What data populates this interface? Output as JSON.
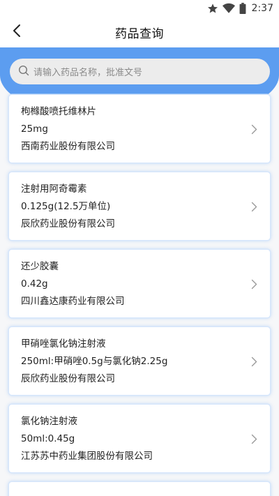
{
  "status_bar": {
    "time": "2:37"
  },
  "nav": {
    "title": "药品查询"
  },
  "search": {
    "placeholder": "请输入药品名称，批准文号"
  },
  "drugs": [
    {
      "name": "枸橼酸喷托维林片",
      "spec": "25mg",
      "company": "西南药业股份有限公司"
    },
    {
      "name": "注射用阿奇霉素",
      "spec": "0.125g(12.5万单位)",
      "company": "辰欣药业股份有限公司"
    },
    {
      "name": "还少胶囊",
      "spec": "0.42g",
      "company": "四川鑫达康药业有限公司"
    },
    {
      "name": "甲硝唑氯化钠注射液",
      "spec": "250ml:甲硝唑0.5g与氯化钠2.25g",
      "company": "辰欣药业股份有限公司"
    },
    {
      "name": "氯化钠注射液",
      "spec": "50ml:0.45g",
      "company": "江苏苏中药业集团股份有限公司"
    }
  ],
  "colors": {
    "accent": "#5c9df0",
    "card_border": "#d6e6fb",
    "search_bg": "#ececec"
  }
}
